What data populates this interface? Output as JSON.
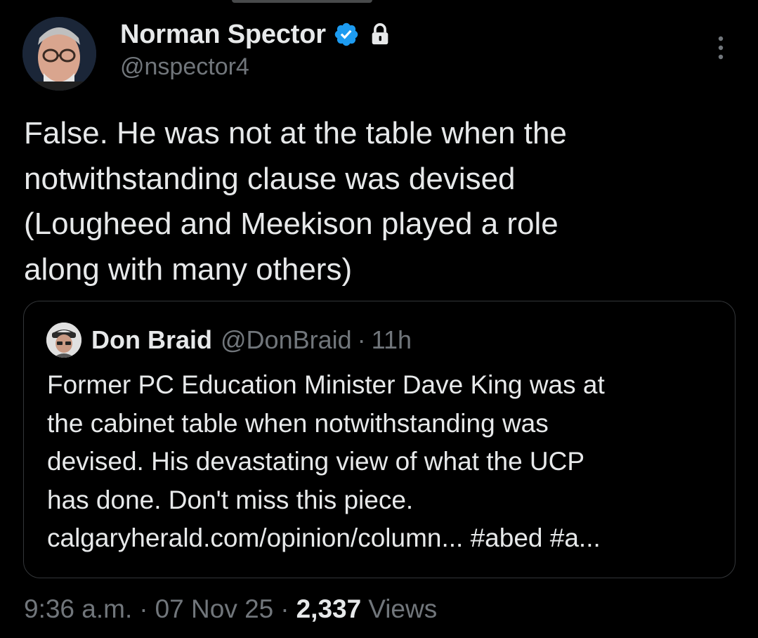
{
  "author": {
    "display_name": "Norman Spector",
    "handle": "@nspector4",
    "verified": true,
    "protected": true
  },
  "tweet": {
    "text": "False. He was not at the table when the\nnotwithstanding clause was devised\n(Lougheed and Meekison played a role\nalong with many others)"
  },
  "quote": {
    "display_name": "Don Braid",
    "handle": "@DonBraid",
    "separator": "·",
    "time": "11h",
    "text": "Former PC Education Minister Dave King was at\nthe cabinet table when notwithstanding was\ndevised. His devastating view of what the UCP\nhas done. Don't miss this piece.\ncalgaryherald.com/opinion/column... #abed #a..."
  },
  "meta": {
    "time": "9:36 a.m.",
    "separator": "·",
    "date": "07 Nov 25",
    "views_count": "2,337",
    "views_label": "Views"
  },
  "icons": {
    "verified": "verified-badge-icon",
    "protected": "lock-icon",
    "more": "more-options-icon"
  },
  "colors": {
    "background": "#000000",
    "text_primary": "#e7e9ea",
    "text_secondary": "#71767b",
    "verified_blue": "#1d9bf0",
    "border": "#333639"
  }
}
